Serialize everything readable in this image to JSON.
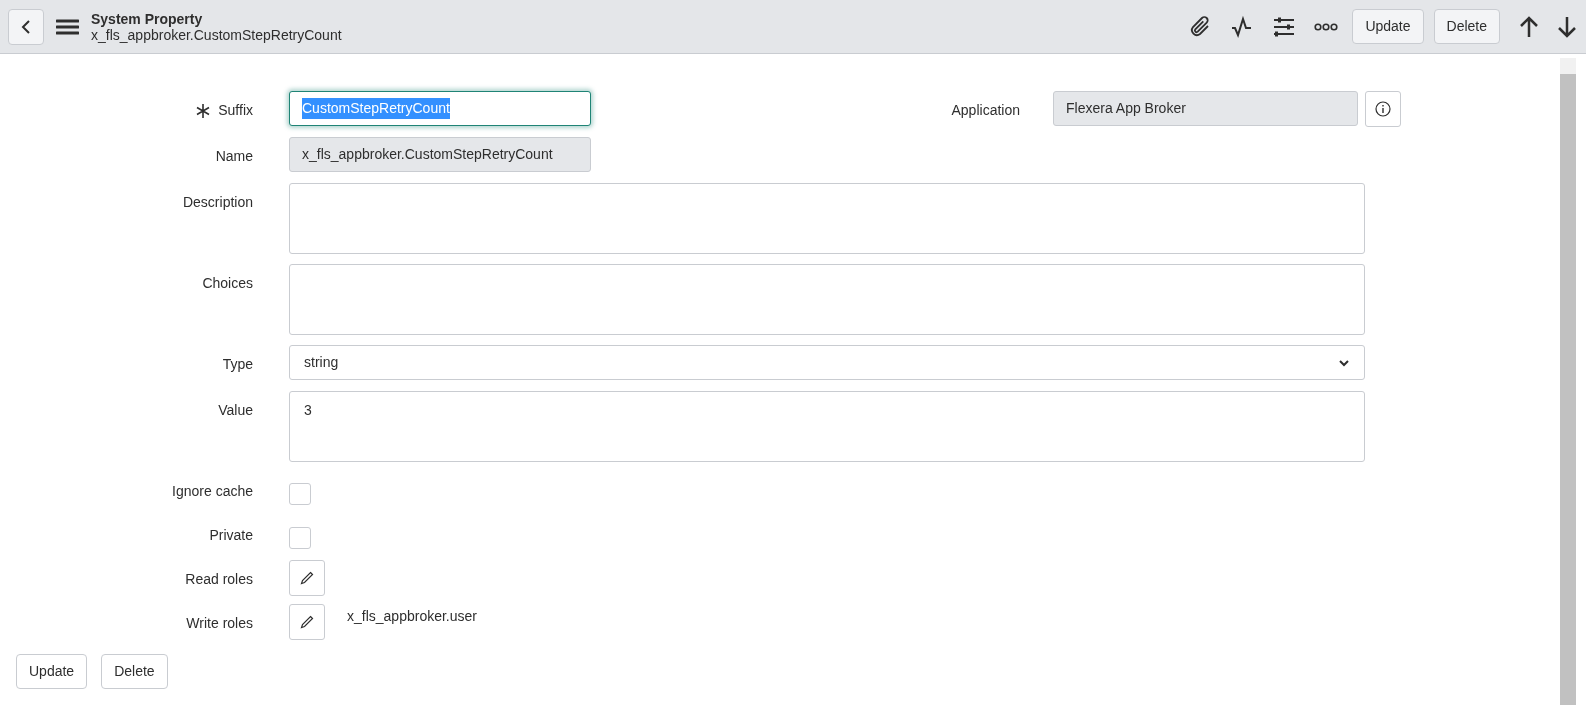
{
  "header": {
    "title": "System Property",
    "subtitle": "x_fls_appbroker.CustomStepRetryCount",
    "buttons": [
      "Update",
      "Delete"
    ]
  },
  "form": {
    "fields": [
      {
        "kind": "text",
        "label": "Suffix",
        "required": true,
        "value": "CustomStepRetryCount",
        "focused": true,
        "text_selected": true,
        "readonly": false
      },
      {
        "kind": "text",
        "label": "Name",
        "required": false,
        "value": "x_fls_appbroker.CustomStepRetryCount",
        "focused": false,
        "text_selected": false,
        "readonly": true
      },
      {
        "kind": "textarea",
        "label": "Description"
      },
      {
        "kind": "textarea",
        "label": "Choices"
      },
      {
        "kind": "select",
        "label": "Type",
        "value": "string"
      },
      {
        "kind": "textarea",
        "label": "Value",
        "value": "3"
      },
      {
        "kind": "checkbox",
        "label": "Ignore cache",
        "checked": false
      },
      {
        "kind": "checkbox",
        "label": "Private",
        "checked": false
      },
      {
        "kind": "roles",
        "label": "Read roles"
      },
      {
        "kind": "roles",
        "label": "Write roles",
        "value": "x_fls_appbroker.user"
      }
    ],
    "application": {
      "label": "Application",
      "value": "Flexera App Broker",
      "readonly": true
    }
  },
  "footer_buttons": [
    "Update",
    "Delete"
  ]
}
